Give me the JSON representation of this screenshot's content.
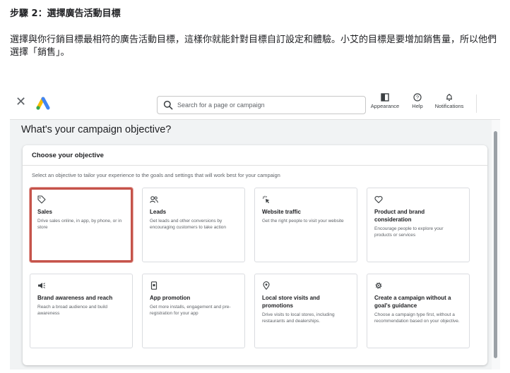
{
  "article": {
    "step_title": "步驟 2：選擇廣告活動目標",
    "description": "選擇與你行銷目標最相符的廣告活動目標，這樣你就能針對目標自訂設定和體驗。小艾的目標是要增加銷售量，所以他們選擇「銷售」。"
  },
  "topbar": {
    "close_icon": "close-icon",
    "logo": "google-ads-logo",
    "search_placeholder": "Search for a page or campaign",
    "tools": [
      {
        "label": "Appearance",
        "icon": "appearance-icon"
      },
      {
        "label": "Help",
        "icon": "help-icon"
      },
      {
        "label": "Notifications",
        "icon": "bell-icon"
      }
    ]
  },
  "page": {
    "heading": "What's your campaign objective?",
    "panel_title": "Choose your objective",
    "panel_subtitle": "Select an objective to tailor your experience to the goals and settings that will work best for your campaign"
  },
  "objectives": [
    {
      "title": "Sales",
      "desc": "Drive sales online, in app, by phone, or in store",
      "icon": "tag-icon",
      "selected": true
    },
    {
      "title": "Leads",
      "desc": "Get leads and other conversions by encouraging customers to take action",
      "icon": "people-icon",
      "selected": false
    },
    {
      "title": "Website traffic",
      "desc": "Get the right people to visit your website",
      "icon": "cursor-click-icon",
      "selected": false
    },
    {
      "title": "Product and brand consideration",
      "desc": "Encourage people to explore your products or services",
      "icon": "heart-icon",
      "selected": false
    },
    {
      "title": "Brand awareness and reach",
      "desc": "Reach a broad audience and build awareness",
      "icon": "megaphone-icon",
      "selected": false
    },
    {
      "title": "App promotion",
      "desc": "Get more installs, engagement and pre-registration for your app",
      "icon": "phone-icon",
      "selected": false
    },
    {
      "title": "Local store visits and promotions",
      "desc": "Drive visits to local stores, including restaurants and dealerships.",
      "icon": "location-pin-icon",
      "selected": false
    },
    {
      "title": "Create a campaign without a goal's guidance",
      "desc": "Choose a campaign type first, without a recommendation based on your objective.",
      "icon": "settings-gear-icon",
      "selected": false
    }
  ],
  "colors": {
    "selected_border": "#c5534a",
    "ads_blue": "#4285f4",
    "ads_yellow": "#fbbc04",
    "ads_green": "#34a853"
  }
}
